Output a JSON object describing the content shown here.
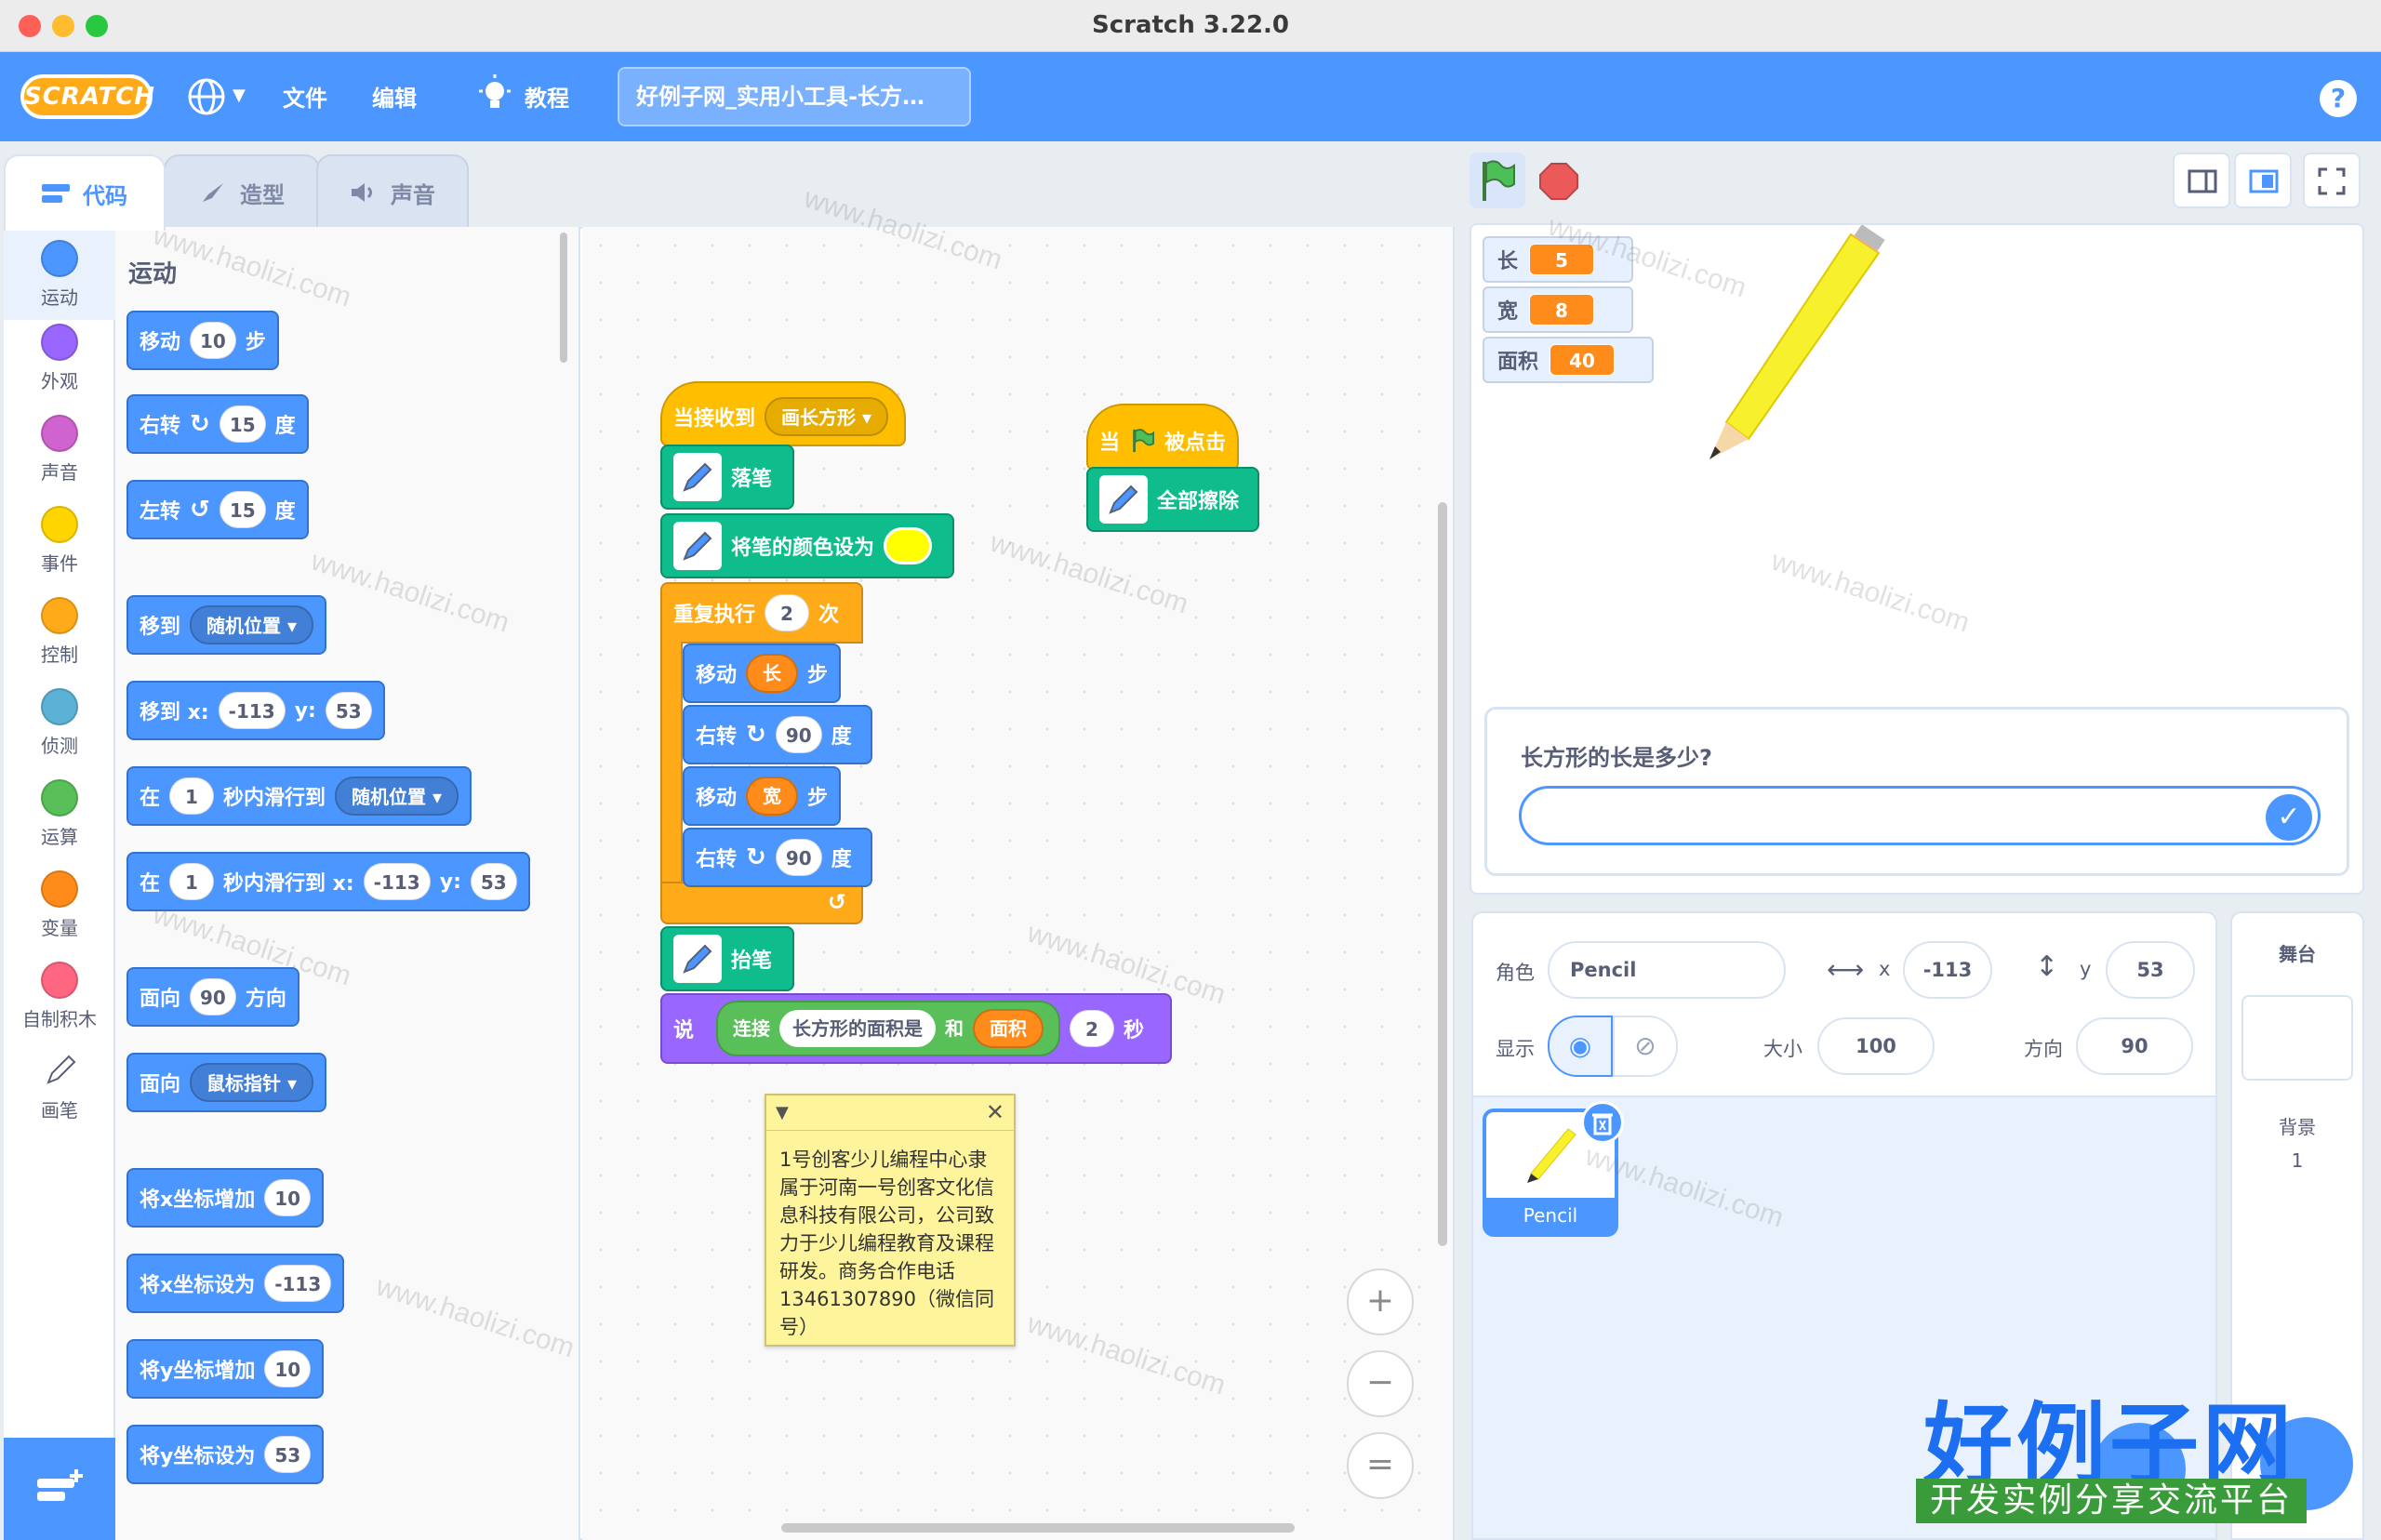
{
  "window": {
    "title": "Scratch 3.22.0"
  },
  "menubar": {
    "logo": "SCRATCH",
    "file": "文件",
    "edit": "编辑",
    "tutorials": "教程",
    "project_title": "好例子网_实用小工具-长方…",
    "help": "?"
  },
  "tabs": {
    "code": "代码",
    "costumes": "造型",
    "sounds": "声音"
  },
  "categories": [
    {
      "label": "运动",
      "color": "#4c97ff"
    },
    {
      "label": "外观",
      "color": "#9966ff"
    },
    {
      "label": "声音",
      "color": "#cf63cf"
    },
    {
      "label": "事件",
      "color": "#ffd500"
    },
    {
      "label": "控制",
      "color": "#ffab19"
    },
    {
      "label": "侦测",
      "color": "#5cb1d6"
    },
    {
      "label": "运算",
      "color": "#59c059"
    },
    {
      "label": "变量",
      "color": "#ff8c1a"
    },
    {
      "label": "自制积木",
      "color": "#ff6680"
    },
    {
      "label": "画笔",
      "color": "#0fbd8c"
    }
  ],
  "palette": {
    "section": "运动",
    "move": {
      "a": "移动",
      "v": "10",
      "b": "步"
    },
    "turn_right": {
      "a": "右转",
      "v": "15",
      "b": "度"
    },
    "turn_left": {
      "a": "左转",
      "v": "15",
      "b": "度"
    },
    "goto": {
      "a": "移到",
      "dd": "随机位置"
    },
    "goto_xy": {
      "a": "移到 x:",
      "x": "-113",
      "b": "y:",
      "y": "53"
    },
    "glide": {
      "a": "在",
      "v": "1",
      "b": "秒内滑行到",
      "dd": "随机位置"
    },
    "glide_xy": {
      "a": "在",
      "v": "1",
      "b": "秒内滑行到 x:",
      "x": "-113",
      "c": "y:",
      "y": "53"
    },
    "point_dir": {
      "a": "面向",
      "v": "90",
      "b": "方向"
    },
    "point_towards": {
      "a": "面向",
      "dd": "鼠标指针"
    },
    "change_x": {
      "a": "将x坐标增加",
      "v": "10"
    },
    "set_x": {
      "a": "将x坐标设为",
      "v": "-113"
    },
    "change_y": {
      "a": "将y坐标增加",
      "v": "10"
    },
    "set_y": {
      "a": "将y坐标设为",
      "v": "53"
    }
  },
  "script1": {
    "hat": "当接收到",
    "hat_dd": "画长方形",
    "pen_down": "落笔",
    "set_color": "将笔的颜色设为",
    "repeat": "重复执行",
    "repeat_n": "2",
    "repeat_unit": "次",
    "move1": "移动",
    "move1_var": "长",
    "move1_unit": "步",
    "turn1": "右转",
    "turn1_v": "90",
    "turn1_unit": "度",
    "move2": "移动",
    "move2_var": "宽",
    "move2_unit": "步",
    "turn2": "右转",
    "turn2_v": "90",
    "turn2_unit": "度",
    "pen_up": "抬笔",
    "say": "说",
    "join": "连接",
    "join_str": "长方形的面积是",
    "and": "和",
    "area_var": "面积",
    "secs": "2",
    "secs_unit": "秒"
  },
  "script2": {
    "hat_a": "当",
    "hat_b": "被点击",
    "clear": "全部擦除"
  },
  "comment": {
    "text": "1号创客少儿编程中心隶属于河南一号创客文化信息科技有限公司，公司致力于少儿编程教育及课程研发。商务合作电话13461307890（微信同号）"
  },
  "zoom": {
    "in": "+",
    "out": "−",
    "reset": "="
  },
  "monitors": [
    {
      "name": "长",
      "value": "5"
    },
    {
      "name": "宽",
      "value": "8"
    },
    {
      "name": "面积",
      "value": "40"
    }
  ],
  "ask": {
    "question": "长方形的长是多少?",
    "answer": ""
  },
  "sprite_info": {
    "sprite_label": "角色",
    "sprite_name": "Pencil",
    "x_label": "x",
    "x": "-113",
    "y_label": "y",
    "y": "53",
    "show_label": "显示",
    "size_label": "大小",
    "size": "100",
    "direction_label": "方向",
    "direction": "90"
  },
  "sprites": [
    {
      "name": "Pencil"
    }
  ],
  "stage_panel": {
    "title": "舞台",
    "backdrops_label": "背景",
    "backdrops_count": "1"
  },
  "watermark": "www.haolizi.com",
  "brand": {
    "title": "好例子网",
    "subtitle": "开发实例分享交流平台"
  }
}
